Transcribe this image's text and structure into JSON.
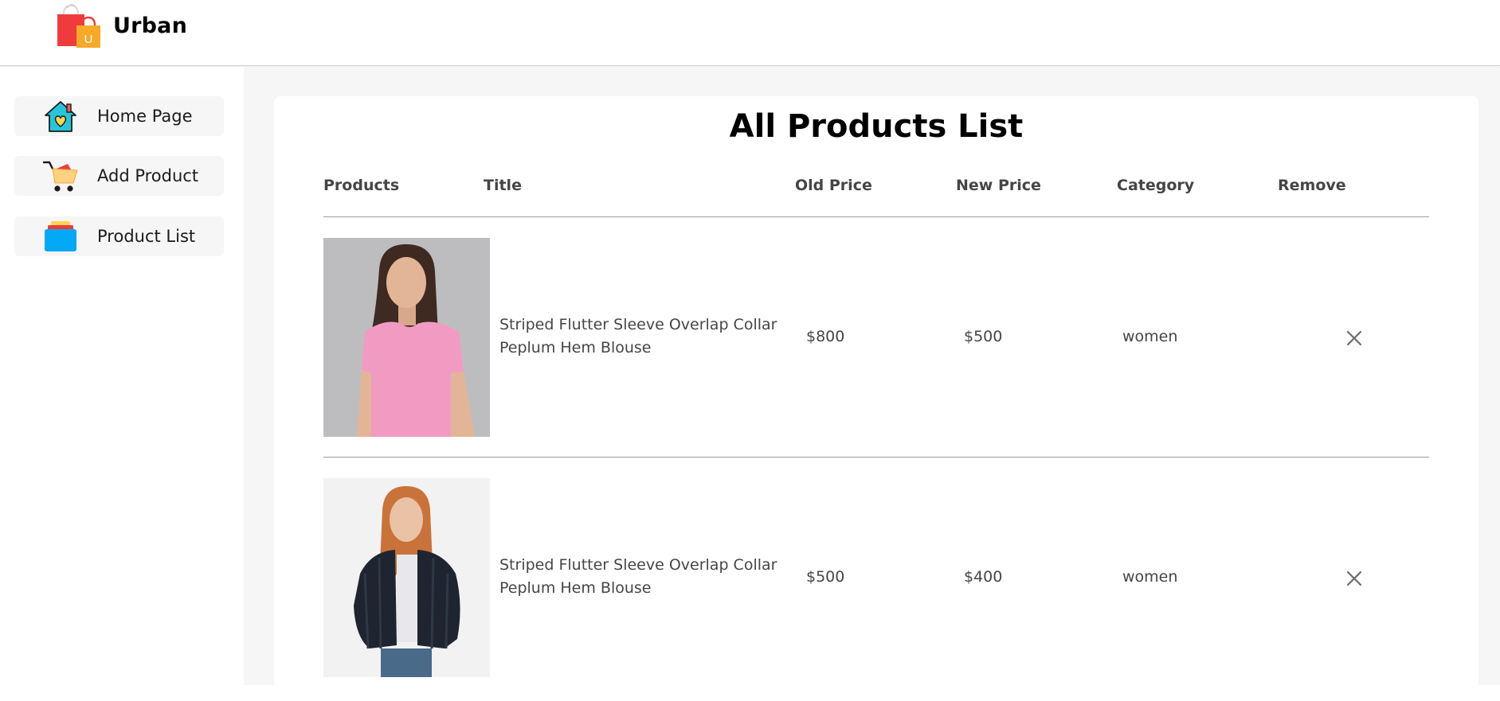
{
  "navbar": {
    "brand": "Urban",
    "logo_icon": "shopping-bags-logo-icon",
    "logo_letter": "U"
  },
  "sidebar": {
    "items": [
      {
        "label": "Home Page",
        "icon": "home-icon"
      },
      {
        "label": "Add Product",
        "icon": "cart-icon"
      },
      {
        "label": "Product List",
        "icon": "stack-icon"
      }
    ]
  },
  "main": {
    "title": "All Products List",
    "columns": [
      "Products",
      "Title",
      "Old Price",
      "New Price",
      "Category",
      "Remove"
    ],
    "products": [
      {
        "image": "woman-pink-top-photo",
        "title_line1": "Striped Flutter Sleeve Overlap Collar",
        "title_line2": "Peplum Hem Blouse",
        "old_price": "$800",
        "new_price": "$500",
        "category": "women"
      },
      {
        "image": "woman-fur-jacket-photo",
        "title_line1": "Striped Flutter Sleeve Overlap Collar",
        "title_line2": "Peplum Hem Blouse",
        "old_price": "$500",
        "new_price": "$400",
        "category": "women"
      }
    ]
  },
  "colors": {
    "accent_red": "#ef3b3b",
    "accent_orange": "#f7a928",
    "text_dark": "#454545",
    "panel_bg": "#f6f6f6"
  }
}
